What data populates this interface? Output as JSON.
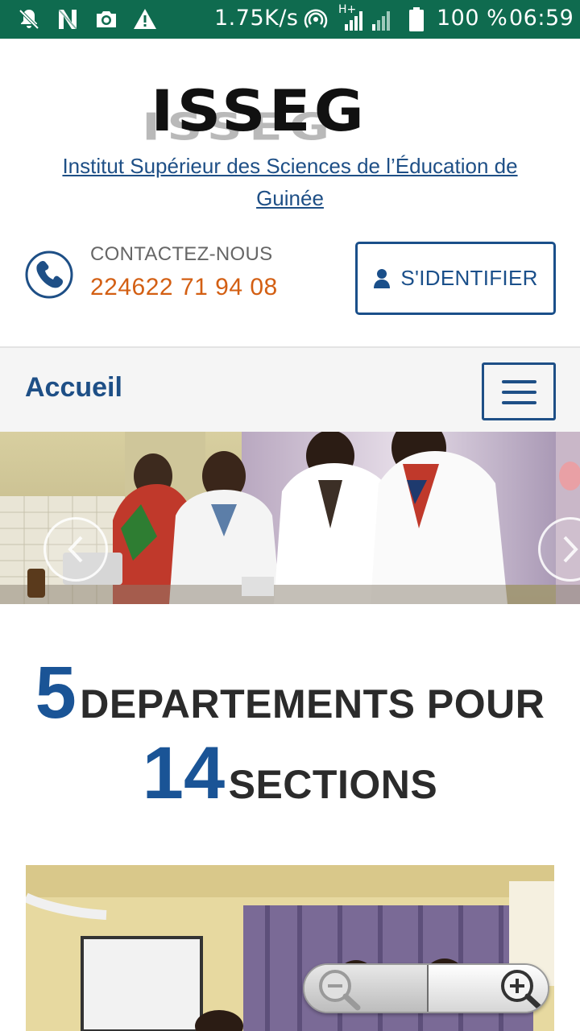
{
  "status_bar": {
    "speed": "1.75K/s",
    "network": "H+",
    "battery": "100 %",
    "time": "06:59",
    "icons": [
      "notifications-off-icon",
      "n-icon",
      "camera-icon",
      "warning-icon",
      "hotspot-icon",
      "signal-icon",
      "battery-icon"
    ]
  },
  "header": {
    "logo_text": "ISSEG",
    "institution": "Institut Supérieur des Sciences de l’Éducation de Guinée",
    "contact_label": "CONTACTEZ-NOUS",
    "contact_phone": "224622 71 94 08",
    "login_label": "S'IDENTIFIER"
  },
  "nav": {
    "home": "Accueil",
    "menu_icon": "hamburger-menu-icon"
  },
  "stats": {
    "departments_number": "5",
    "departments_text": "DEPARTEMENTS POUR",
    "sections_number": "14",
    "sections_text": "SECTIONS"
  },
  "colors": {
    "status_bar": "#0f6b4f",
    "primary": "#1a4f8a",
    "accent_phone": "#d35f13",
    "nav_bg": "#f5f5f5"
  }
}
